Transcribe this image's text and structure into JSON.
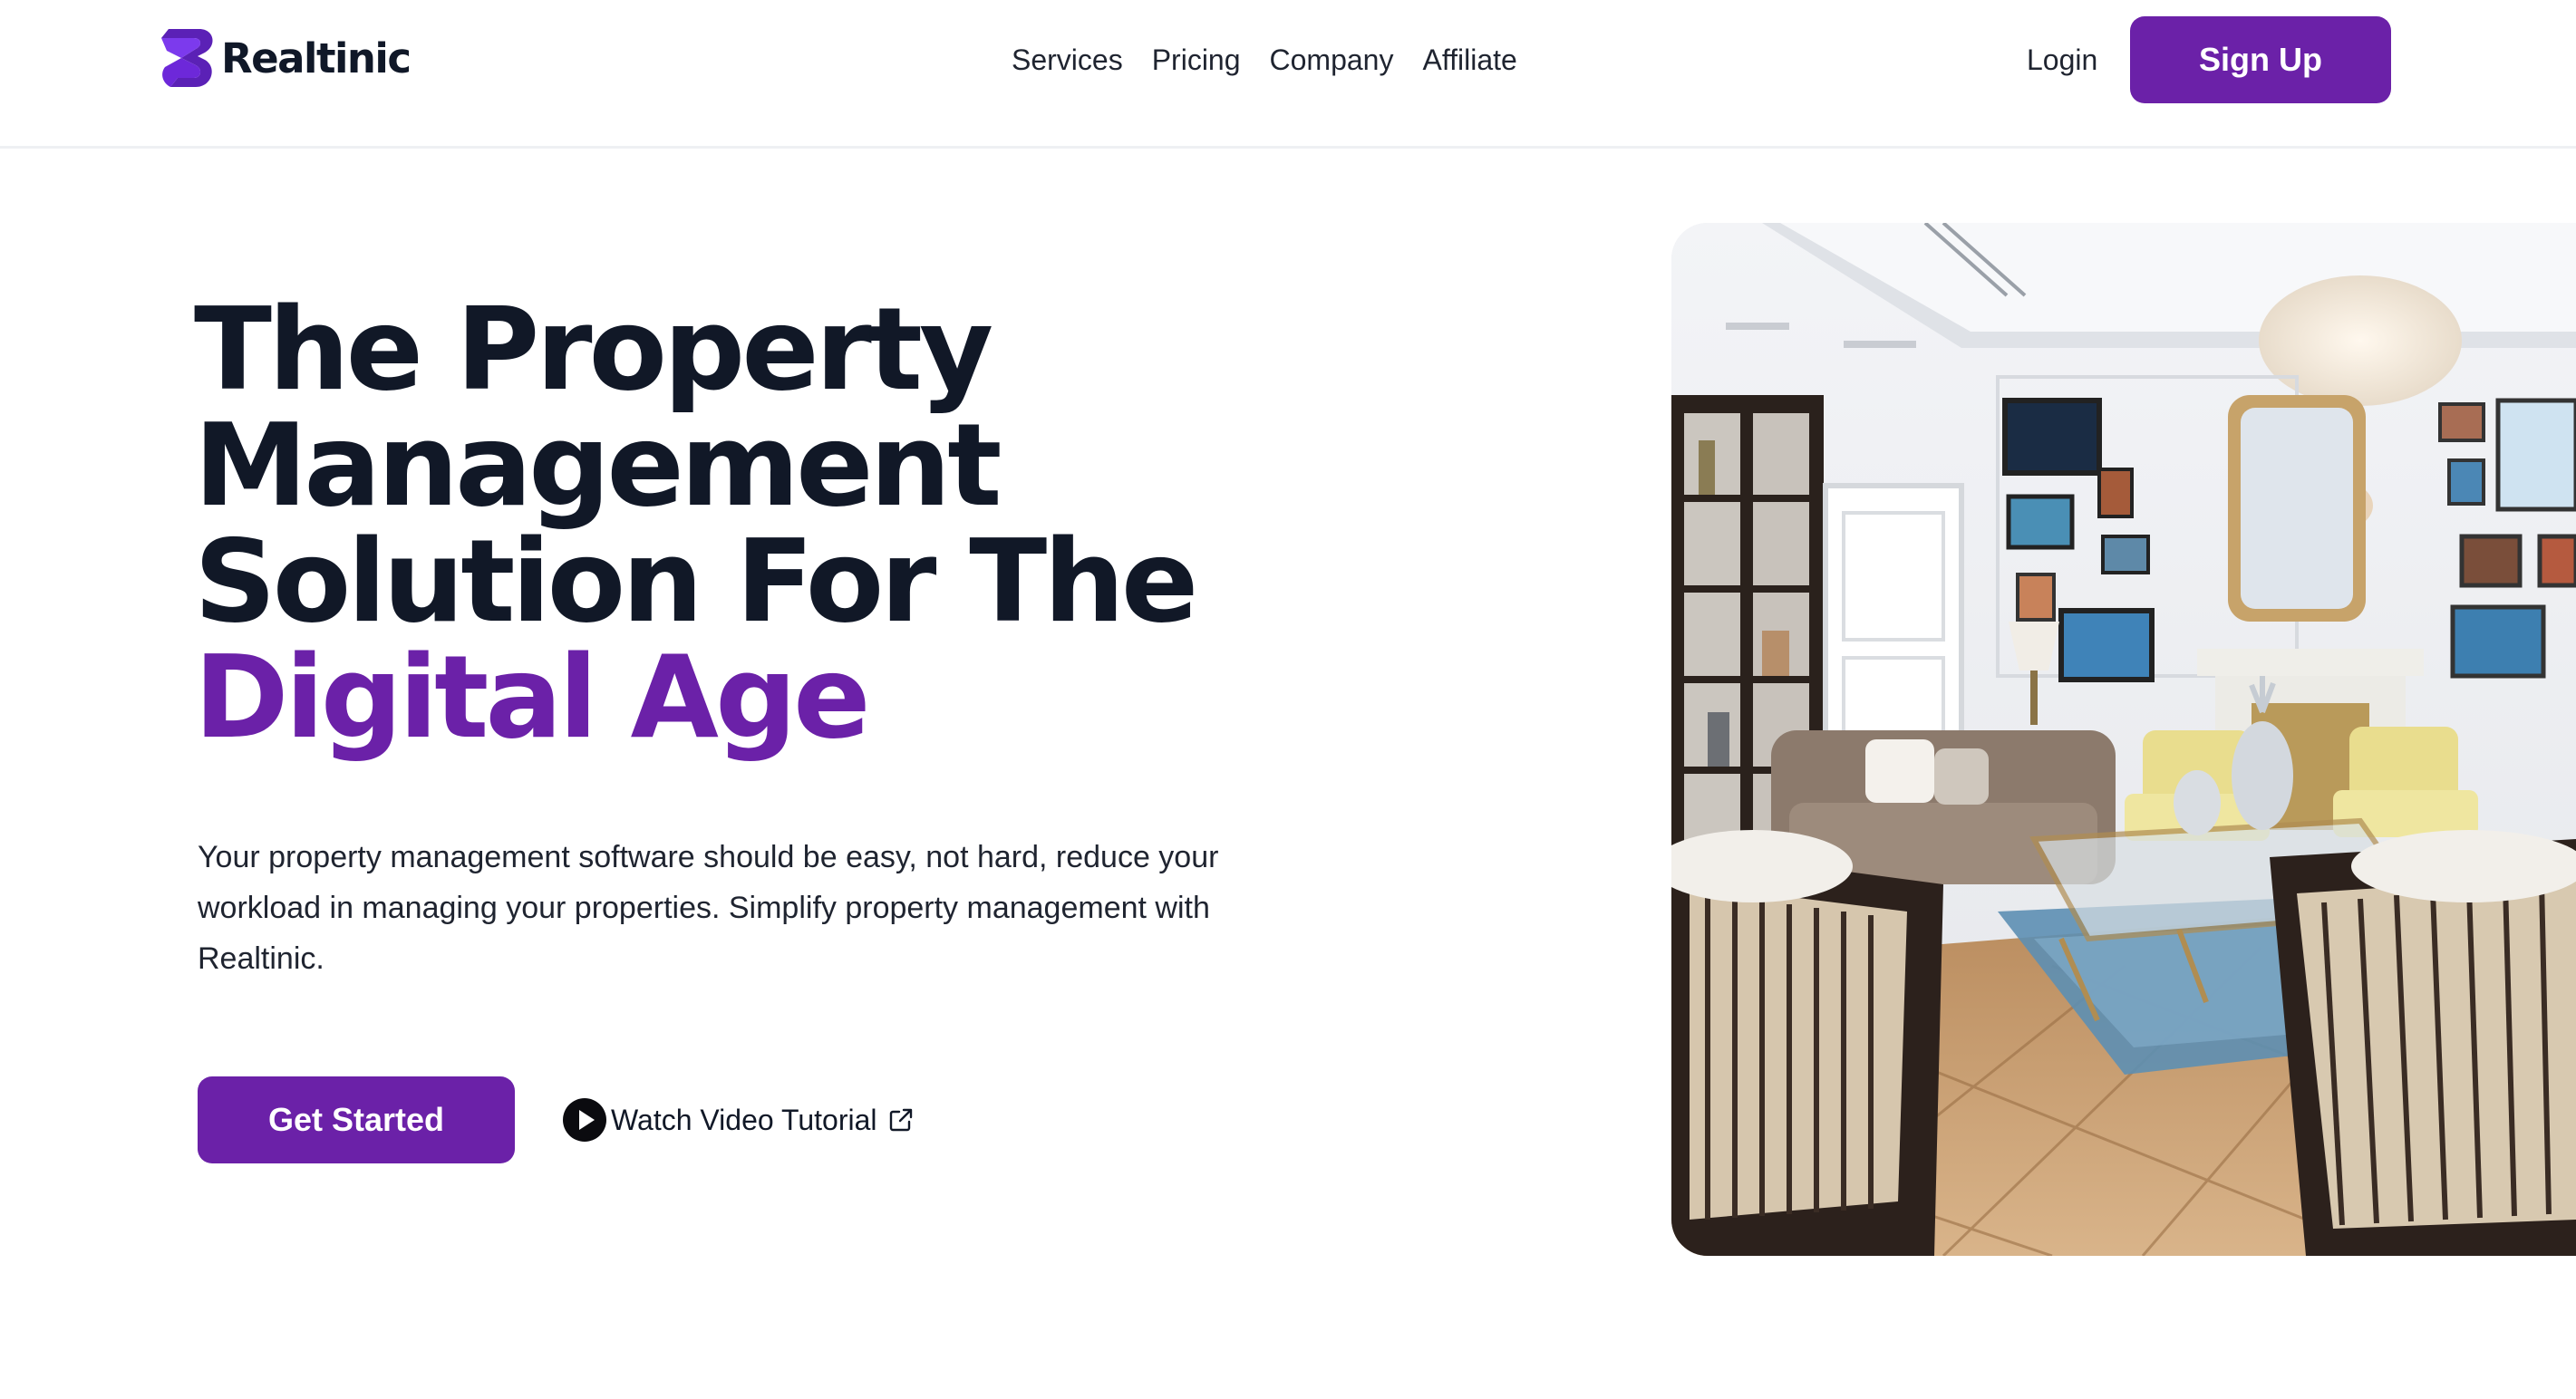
{
  "brand": {
    "name": "Realtinic",
    "logo_icon": "realtinic-logo-icon",
    "color": "#6b21a8"
  },
  "nav": {
    "items": [
      {
        "label": "Services"
      },
      {
        "label": "Pricing"
      },
      {
        "label": "Company"
      },
      {
        "label": "Affiliate"
      }
    ],
    "login_label": "Login",
    "signup_label": "Sign Up"
  },
  "hero": {
    "title_lines": [
      "The Property",
      "Management",
      "Solution For The"
    ],
    "title_accent": "Digital Age",
    "description": "Your property management software should be easy, not hard, reduce your workload in managing your properties. Simplify property management with Realtinic.",
    "cta_label": "Get Started",
    "video_label": "Watch Video Tutorial",
    "video_icon": "play-circle-icon",
    "external_icon": "external-link-icon",
    "image": "living-room-photo"
  },
  "colors": {
    "accent": "#6b21a8",
    "text": "#111827",
    "background": "#ffffff"
  }
}
